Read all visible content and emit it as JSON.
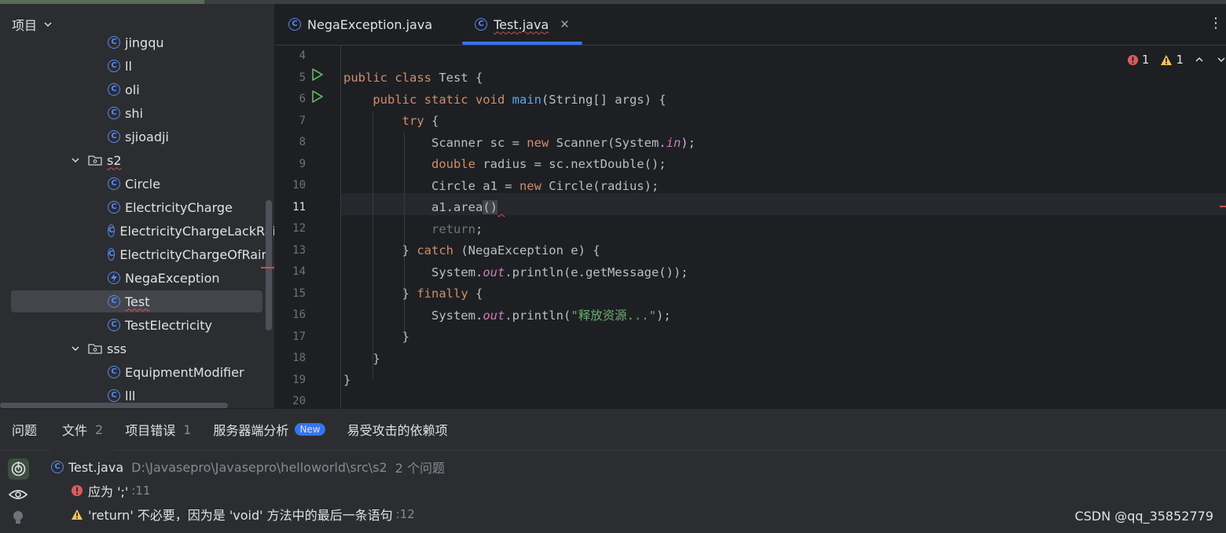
{
  "project": {
    "title": "项目",
    "tree": [
      {
        "type": "class",
        "label": "jingqu",
        "indent": 1
      },
      {
        "type": "class",
        "label": "ll",
        "indent": 1
      },
      {
        "type": "class",
        "label": "oli",
        "indent": 1
      },
      {
        "type": "class",
        "label": "shi",
        "indent": 1
      },
      {
        "type": "class",
        "label": "sjioadji",
        "indent": 1
      },
      {
        "type": "folder",
        "label": "s2",
        "indent": 0,
        "squiggle": true
      },
      {
        "type": "class",
        "label": "Circle",
        "indent": 1
      },
      {
        "type": "class",
        "label": "ElectricityCharge",
        "indent": 1
      },
      {
        "type": "class",
        "label": "ElectricityChargeLackRai",
        "indent": 1
      },
      {
        "type": "class",
        "label": "ElectricityChargeOfRain",
        "indent": 1
      },
      {
        "type": "exception",
        "label": "NegaException",
        "indent": 1
      },
      {
        "type": "class",
        "label": "Test",
        "indent": 1,
        "selected": true,
        "squiggle": true
      },
      {
        "type": "class",
        "label": "TestElectricity",
        "indent": 1
      },
      {
        "type": "folder",
        "label": "sss",
        "indent": 0
      },
      {
        "type": "class",
        "label": "EquipmentModifier",
        "indent": 1
      },
      {
        "type": "class",
        "label": "lll",
        "indent": 1
      }
    ]
  },
  "editor": {
    "tabs": [
      {
        "label": "NegaException.java",
        "active": false
      },
      {
        "label": "Test.java",
        "active": true
      }
    ],
    "current_line": 11,
    "line_numbers": [
      "4",
      "5",
      "6",
      "7",
      "8",
      "9",
      "10",
      "11",
      "12",
      "13",
      "14",
      "15",
      "16",
      "17",
      "18",
      "19",
      "20"
    ],
    "inspections": {
      "errors": "1",
      "warnings": "1"
    }
  },
  "problems": {
    "tabs": [
      {
        "label": "问题",
        "count": ""
      },
      {
        "label": "文件",
        "count": "2"
      },
      {
        "label": "项目错误",
        "count": "1"
      },
      {
        "label": "服务器端分析",
        "badge": "New"
      },
      {
        "label": "易受攻击的依赖项",
        "count": ""
      }
    ],
    "file": {
      "name": "Test.java",
      "path": "D:\\Javasepro\\Javasepro\\helloworld\\src\\s2",
      "count": "2 个问题"
    },
    "items": [
      {
        "severity": "error",
        "text": "应为 ';'",
        "line": ":11"
      },
      {
        "severity": "warning",
        "text": "'return' 不必要，因为是 'void' 方法中的最后一条语句",
        "line": ":12"
      }
    ]
  },
  "watermark": "CSDN @qq_35852779",
  "colors": {
    "accent": "#3574f0",
    "keyword": "#cf8e6d",
    "function": "#56a8f5",
    "string": "#6aab73",
    "error": "#db5c5c",
    "warning": "#f2c55c"
  }
}
